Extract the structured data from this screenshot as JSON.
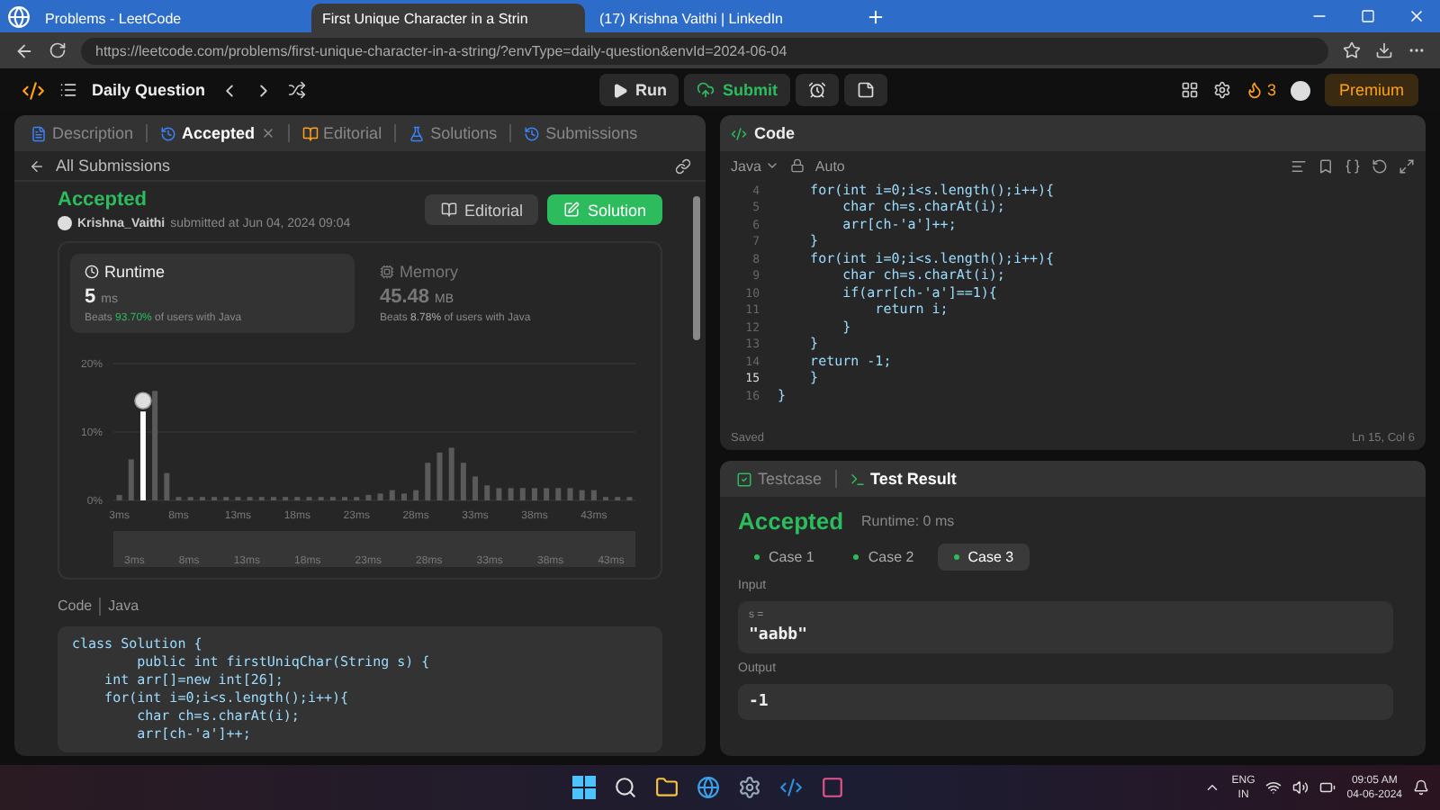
{
  "browser": {
    "tabs": [
      {
        "title": "Problems - LeetCode",
        "selected": false
      },
      {
        "title": "First Unique Character in a Strin",
        "selected": true
      },
      {
        "title": "(17) Krishna Vaithi | LinkedIn",
        "selected": false
      }
    ],
    "url": "https://leetcode.com/problems/first-unique-character-in-a-string/?envType=daily-question&envId=2024-06-04"
  },
  "header": {
    "title": "Daily Question",
    "run": "Run",
    "submit": "Submit",
    "streak": "3",
    "premium": "Premium"
  },
  "left_panel": {
    "tabs": [
      {
        "label": "Description",
        "selected": false,
        "closable": false
      },
      {
        "label": "Accepted",
        "selected": true,
        "closable": true
      },
      {
        "label": "Editorial",
        "selected": false,
        "closable": false
      },
      {
        "label": "Solutions",
        "selected": false,
        "closable": false
      },
      {
        "label": "Submissions",
        "selected": false,
        "closable": false
      }
    ],
    "back_link": "All Submissions",
    "status": "Accepted",
    "user": "Krishna_Vaithi",
    "submitted": "submitted at Jun 04, 2024 09:04",
    "buttons": [
      {
        "label": "Editorial",
        "kind": "secondary"
      },
      {
        "label": "Solution",
        "kind": "primary"
      }
    ],
    "stats": [
      {
        "kind": "runtime",
        "label": "Runtime",
        "value": "5",
        "unit": "ms",
        "beats": "Beats",
        "percent": "93.70%",
        "suffix": "of users with Java",
        "selected": true
      },
      {
        "kind": "memory",
        "label": "Memory",
        "value": "45.48",
        "unit": "MB",
        "beats": "Beats",
        "percent": "8.78%",
        "suffix": "of users with Java",
        "selected": false
      }
    ],
    "chart_data": {
      "type": "bar",
      "xlim": [
        2.5,
        46.5
      ],
      "x": [
        3,
        4,
        5,
        6,
        7,
        8,
        9,
        10,
        11,
        12,
        13,
        14,
        15,
        16,
        17,
        18,
        19,
        20,
        21,
        22,
        23,
        24,
        25,
        26,
        27,
        28,
        29,
        30,
        31,
        32,
        33,
        34,
        35,
        36,
        37,
        38,
        39,
        40,
        41,
        42,
        43,
        44,
        45,
        46
      ],
      "series": [
        {
          "color": "#5a5a5a",
          "values": [
            0.8,
            6,
            null,
            16,
            4,
            0.5,
            0.5,
            0.5,
            0.5,
            0.5,
            0.5,
            0.5,
            0.5,
            0.5,
            0.5,
            0.5,
            0.5,
            0.5,
            0.5,
            0.5,
            0.5,
            0.8,
            1,
            1.5,
            1,
            1.5,
            5.5,
            7,
            7.7,
            5.5,
            3.5,
            2.2,
            1.8,
            1.8,
            1.8,
            1.8,
            1.8,
            1.8,
            1.8,
            1.5,
            1.5,
            0.5,
            0.5,
            0.5
          ]
        },
        {
          "color": "#ffffff",
          "values": [
            null,
            null,
            13,
            null,
            null,
            null,
            null,
            null,
            null,
            null,
            null,
            null,
            null,
            null,
            null,
            null,
            null,
            null,
            null,
            null,
            null,
            null,
            null,
            null,
            null,
            null,
            null,
            null,
            null,
            null,
            null,
            null,
            null,
            null,
            null,
            null,
            null,
            null,
            null,
            null,
            null,
            null,
            null,
            null
          ]
        }
      ],
      "ylim": [
        0,
        20
      ],
      "yticks": [
        {
          "value": 0,
          "label": "0%"
        },
        {
          "value": 10,
          "label": "10%"
        },
        {
          "value": 20,
          "label": "20%"
        }
      ],
      "xticks": [
        {
          "value": 3,
          "label": "3ms"
        },
        {
          "value": 8,
          "label": "8ms"
        },
        {
          "value": 13,
          "label": "13ms"
        },
        {
          "value": 18,
          "label": "18ms"
        },
        {
          "value": 23,
          "label": "23ms"
        },
        {
          "value": 28,
          "label": "28ms"
        },
        {
          "value": 33,
          "label": "33ms"
        },
        {
          "value": 38,
          "label": "38ms"
        },
        {
          "value": 43,
          "label": "43ms"
        }
      ]
    },
    "navigator_labels": [
      "3ms",
      "8ms",
      "13ms",
      "18ms",
      "23ms",
      "28ms",
      "33ms",
      "38ms",
      "43ms"
    ],
    "code_label": "Code",
    "code_language": "Java",
    "code_lines": [
      "class Solution {",
      "        public int firstUniqChar(String s) {",
      "    int arr[]=new int[26];",
      "    for(int i=0;i<s.length();i++){",
      "        char ch=s.charAt(i);",
      "        arr[ch-'a']++;"
    ]
  },
  "editor": {
    "title": "Code",
    "language": "Java",
    "mode": "Auto",
    "lines": [
      {
        "number": "4",
        "text": "    for(int i=0;i<s.length();i++){",
        "active": false
      },
      {
        "number": "5",
        "text": "        char ch=s.charAt(i);",
        "active": false
      },
      {
        "number": "6",
        "text": "        arr[ch-'a']++;",
        "active": false
      },
      {
        "number": "7",
        "text": "    }",
        "active": false
      },
      {
        "number": "8",
        "text": "    for(int i=0;i<s.length();i++){",
        "active": false
      },
      {
        "number": "9",
        "text": "        char ch=s.charAt(i);",
        "active": false
      },
      {
        "number": "10",
        "text": "        if(arr[ch-'a']==1){",
        "active": false
      },
      {
        "number": "11",
        "text": "            return i;",
        "active": false
      },
      {
        "number": "12",
        "text": "        }",
        "active": false
      },
      {
        "number": "13",
        "text": "    }",
        "active": false
      },
      {
        "number": "14",
        "text": "    return -1;",
        "active": false
      },
      {
        "number": "15",
        "text": "    }",
        "active": true
      },
      {
        "number": "16",
        "text": "}",
        "active": false
      }
    ],
    "saved": "Saved",
    "position": "Ln 15, Col 6"
  },
  "results": {
    "tabs": [
      {
        "label": "Testcase",
        "selected": false
      },
      {
        "label": "Test Result",
        "selected": true
      }
    ],
    "status": "Accepted",
    "runtime": "Runtime: 0 ms",
    "cases": [
      {
        "label": "Case 1",
        "selected": false
      },
      {
        "label": "Case 2",
        "selected": false
      },
      {
        "label": "Case 3",
        "selected": true
      }
    ],
    "input_label": "Input",
    "input_name": "s =",
    "input_value": "\"aabb\"",
    "output_label": "Output",
    "output_value": "-1"
  },
  "taskbar": {
    "language": "ENG",
    "region": "IN",
    "time": "09:05 AM",
    "date": "04-06-2024"
  }
}
